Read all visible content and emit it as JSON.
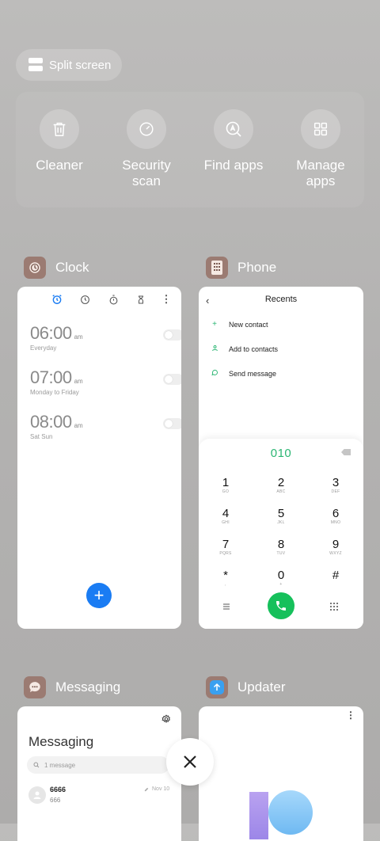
{
  "split_screen": {
    "label": "Split screen",
    "icon": "split-screen-icon"
  },
  "quick_actions": [
    {
      "label": "Cleaner",
      "icon": "trash-icon"
    },
    {
      "label": "Security\nscan",
      "icon": "security-scan-icon"
    },
    {
      "label": "Find apps",
      "icon": "find-apps-icon"
    },
    {
      "label": "Manage\napps",
      "icon": "grid-icon"
    }
  ],
  "apps": {
    "clock": {
      "name": "Clock",
      "alarms": [
        {
          "time": "06:00",
          "ampm": "am",
          "repeat": "Everyday",
          "enabled": false
        },
        {
          "time": "07:00",
          "ampm": "am",
          "repeat": "Monday to Friday",
          "enabled": false
        },
        {
          "time": "08:00",
          "ampm": "am",
          "repeat": "Sat Sun",
          "enabled": false
        }
      ],
      "fab": "+"
    },
    "phone": {
      "name": "Phone",
      "title": "Recents",
      "options": [
        "New contact",
        "Add to contacts",
        "Send message"
      ],
      "dialed": "010",
      "keys": [
        {
          "d": "1",
          "l": "GO"
        },
        {
          "d": "2",
          "l": "ABC"
        },
        {
          "d": "3",
          "l": "DEF"
        },
        {
          "d": "4",
          "l": "GHI"
        },
        {
          "d": "5",
          "l": "JKL"
        },
        {
          "d": "6",
          "l": "MNO"
        },
        {
          "d": "7",
          "l": "PQRS"
        },
        {
          "d": "8",
          "l": "TUV"
        },
        {
          "d": "9",
          "l": "WXYZ"
        },
        {
          "d": "*",
          "l": ","
        },
        {
          "d": "0",
          "l": "+"
        },
        {
          "d": "#",
          "l": ""
        }
      ]
    },
    "messaging": {
      "name": "Messaging",
      "title": "Messaging",
      "search_placeholder": "1 message",
      "thread": {
        "name": "6666",
        "preview": "666",
        "date": "Nov 10"
      }
    },
    "updater": {
      "name": "Updater"
    }
  },
  "colors": {
    "accent_blue": "#1a7cf3",
    "accent_green": "#16c05b",
    "dial_green": "#2bb673"
  }
}
